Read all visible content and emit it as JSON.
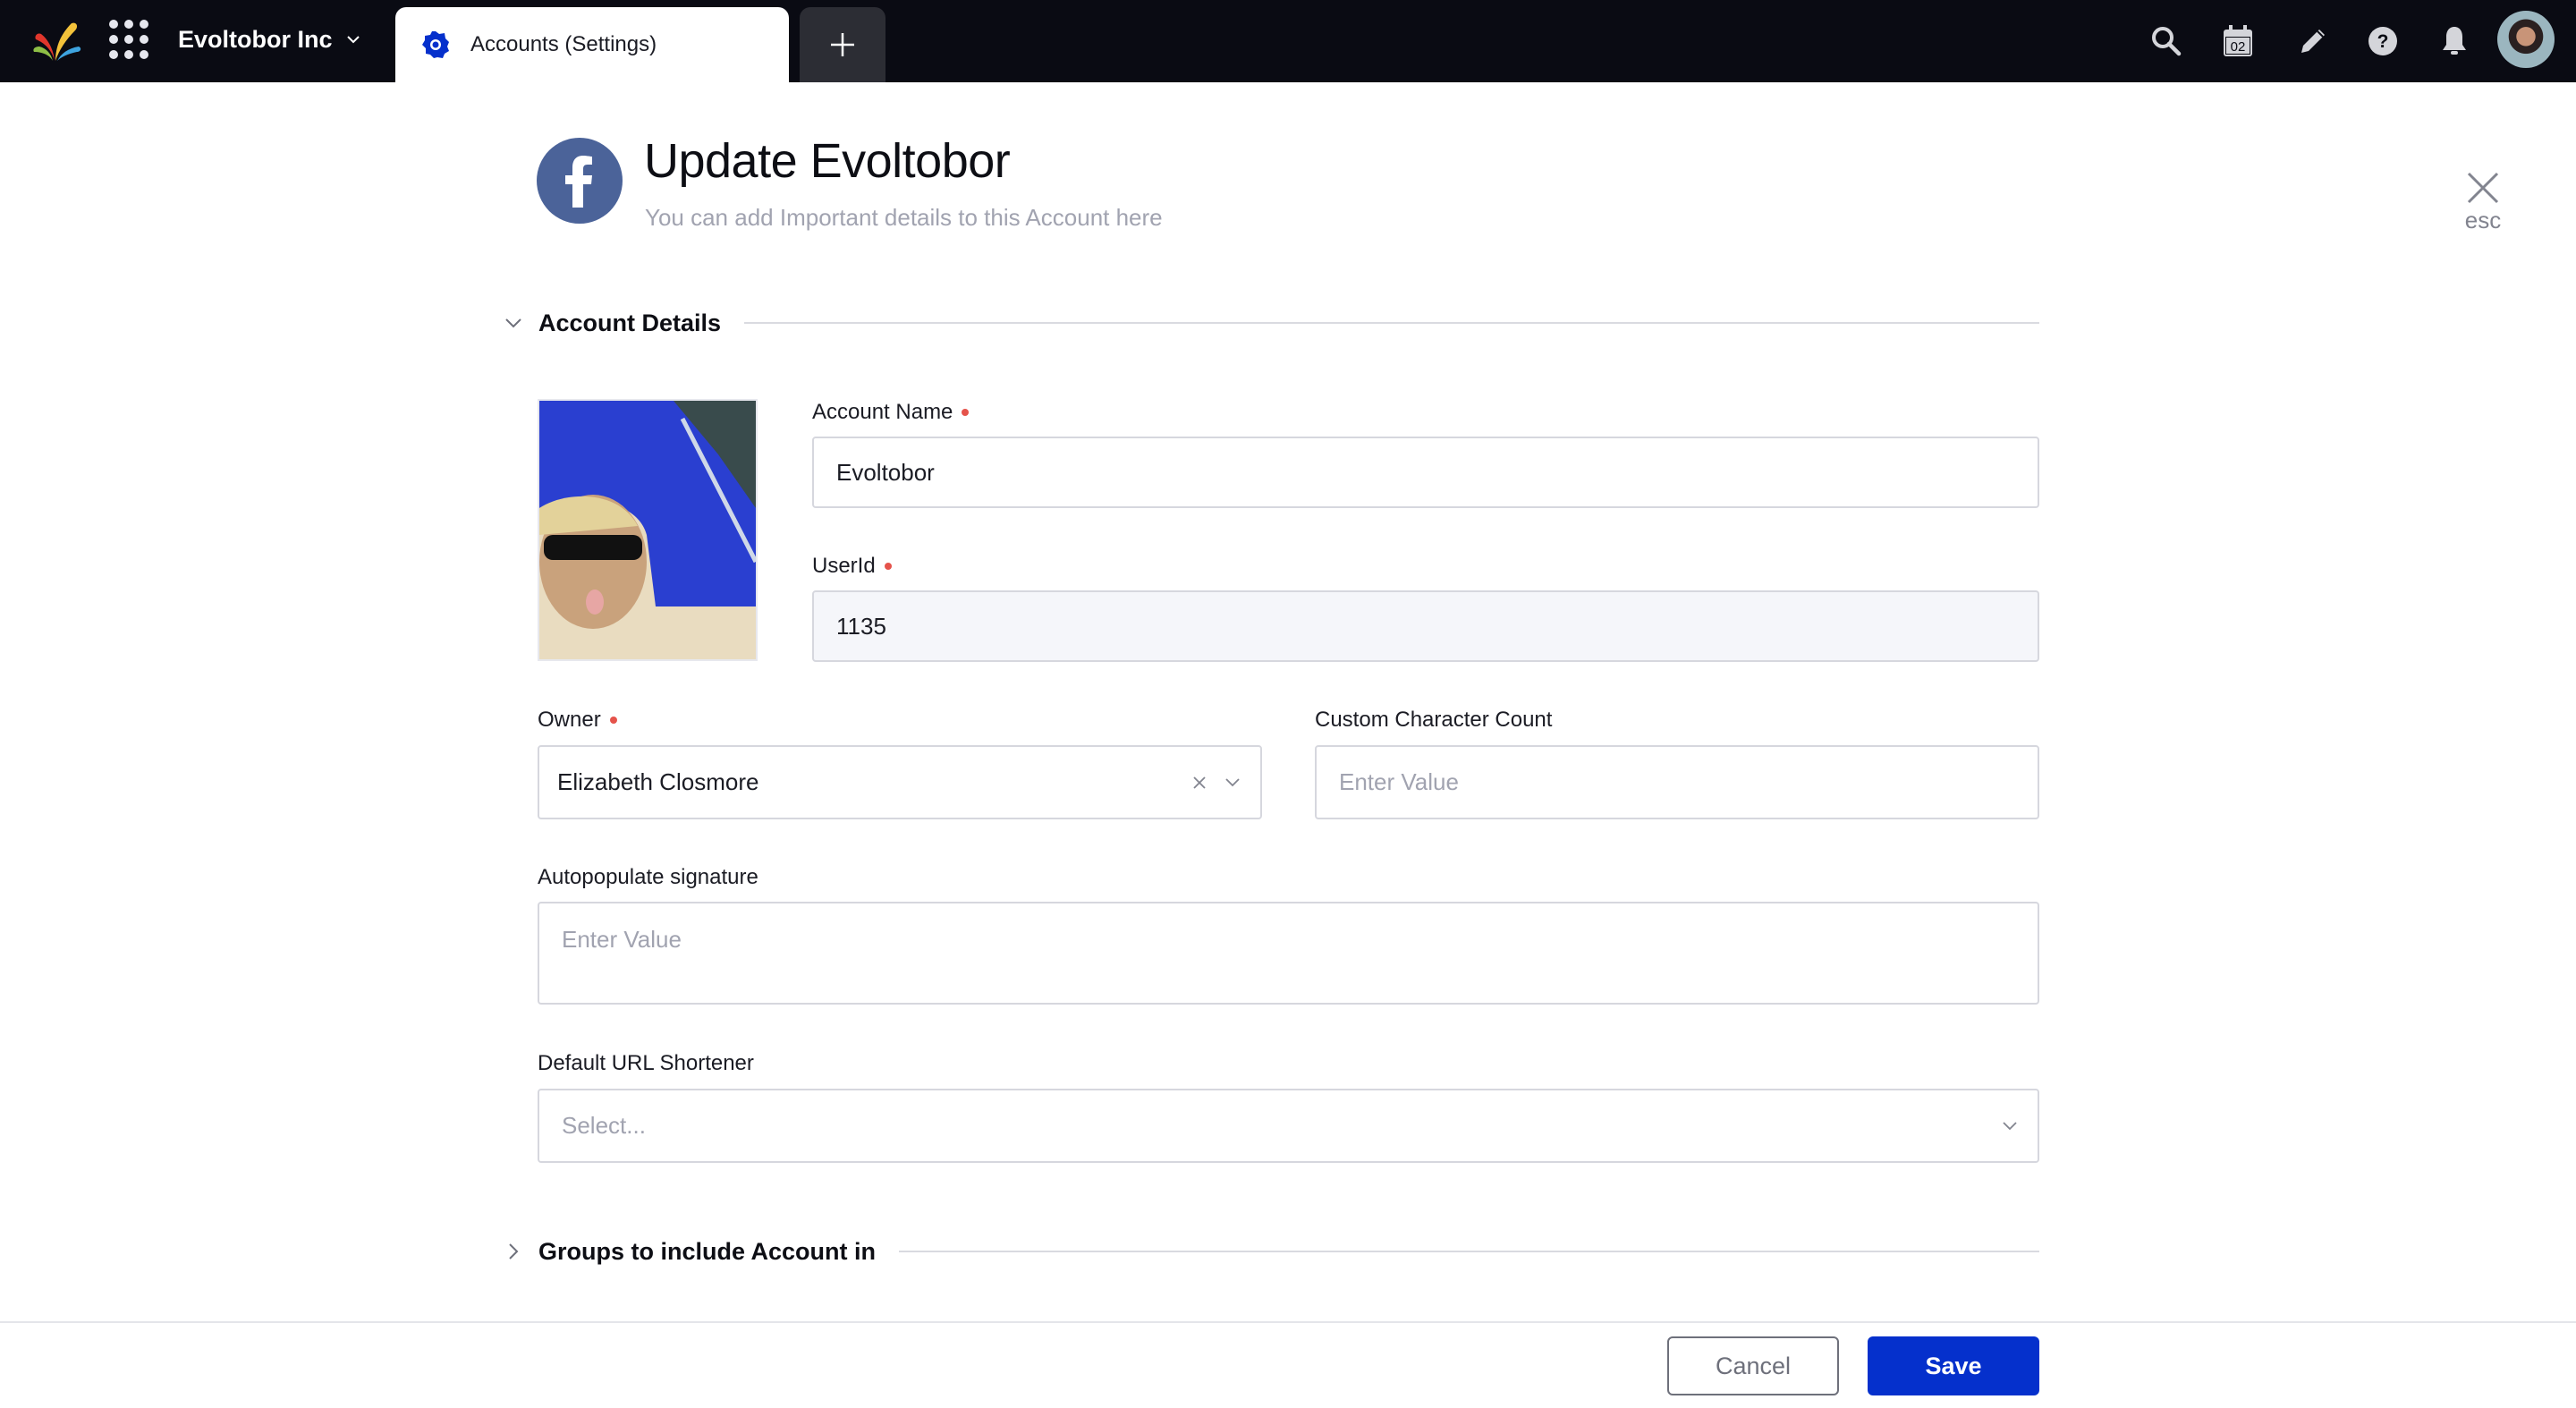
{
  "topbar": {
    "workspace": "Evoltobor Inc",
    "active_tab": {
      "label": "Accounts (Settings)",
      "icon": "gear-icon"
    },
    "new_tab_icon": "plus-icon",
    "actions": [
      {
        "name": "search-icon"
      },
      {
        "name": "calendar-icon",
        "text": "02"
      },
      {
        "name": "pencil-icon"
      },
      {
        "name": "help-icon"
      },
      {
        "name": "bell-icon"
      }
    ]
  },
  "header": {
    "network_icon": "facebook-icon",
    "title": "Update Evoltobor",
    "subtitle": "You can add Important details to this Account here",
    "close_label": "esc"
  },
  "sections": {
    "account_details": {
      "title": "Account Details",
      "expanded": true
    },
    "groups": {
      "title": "Groups to include Account in",
      "expanded": false
    }
  },
  "fields": {
    "account_name": {
      "label": "Account Name",
      "required": true,
      "value": "Evoltobor"
    },
    "user_id": {
      "label": "UserId",
      "required": true,
      "value": "1135",
      "readonly": true
    },
    "owner": {
      "label": "Owner",
      "required": true,
      "value": "Elizabeth Closmore"
    },
    "custom_char_count": {
      "label": "Custom Character Count",
      "required": false,
      "placeholder": "Enter Value"
    },
    "autopopulate_signature": {
      "label": "Autopopulate signature",
      "required": false,
      "placeholder": "Enter Value"
    },
    "url_shortener": {
      "label": "Default URL Shortener",
      "required": false,
      "placeholder": "Select..."
    }
  },
  "footer": {
    "cancel_label": "Cancel",
    "save_label": "Save"
  },
  "colors": {
    "topbar_bg": "#0a0b13",
    "primary": "#0530cc",
    "facebook": "#4b6399",
    "required_dot": "#e5534b"
  }
}
